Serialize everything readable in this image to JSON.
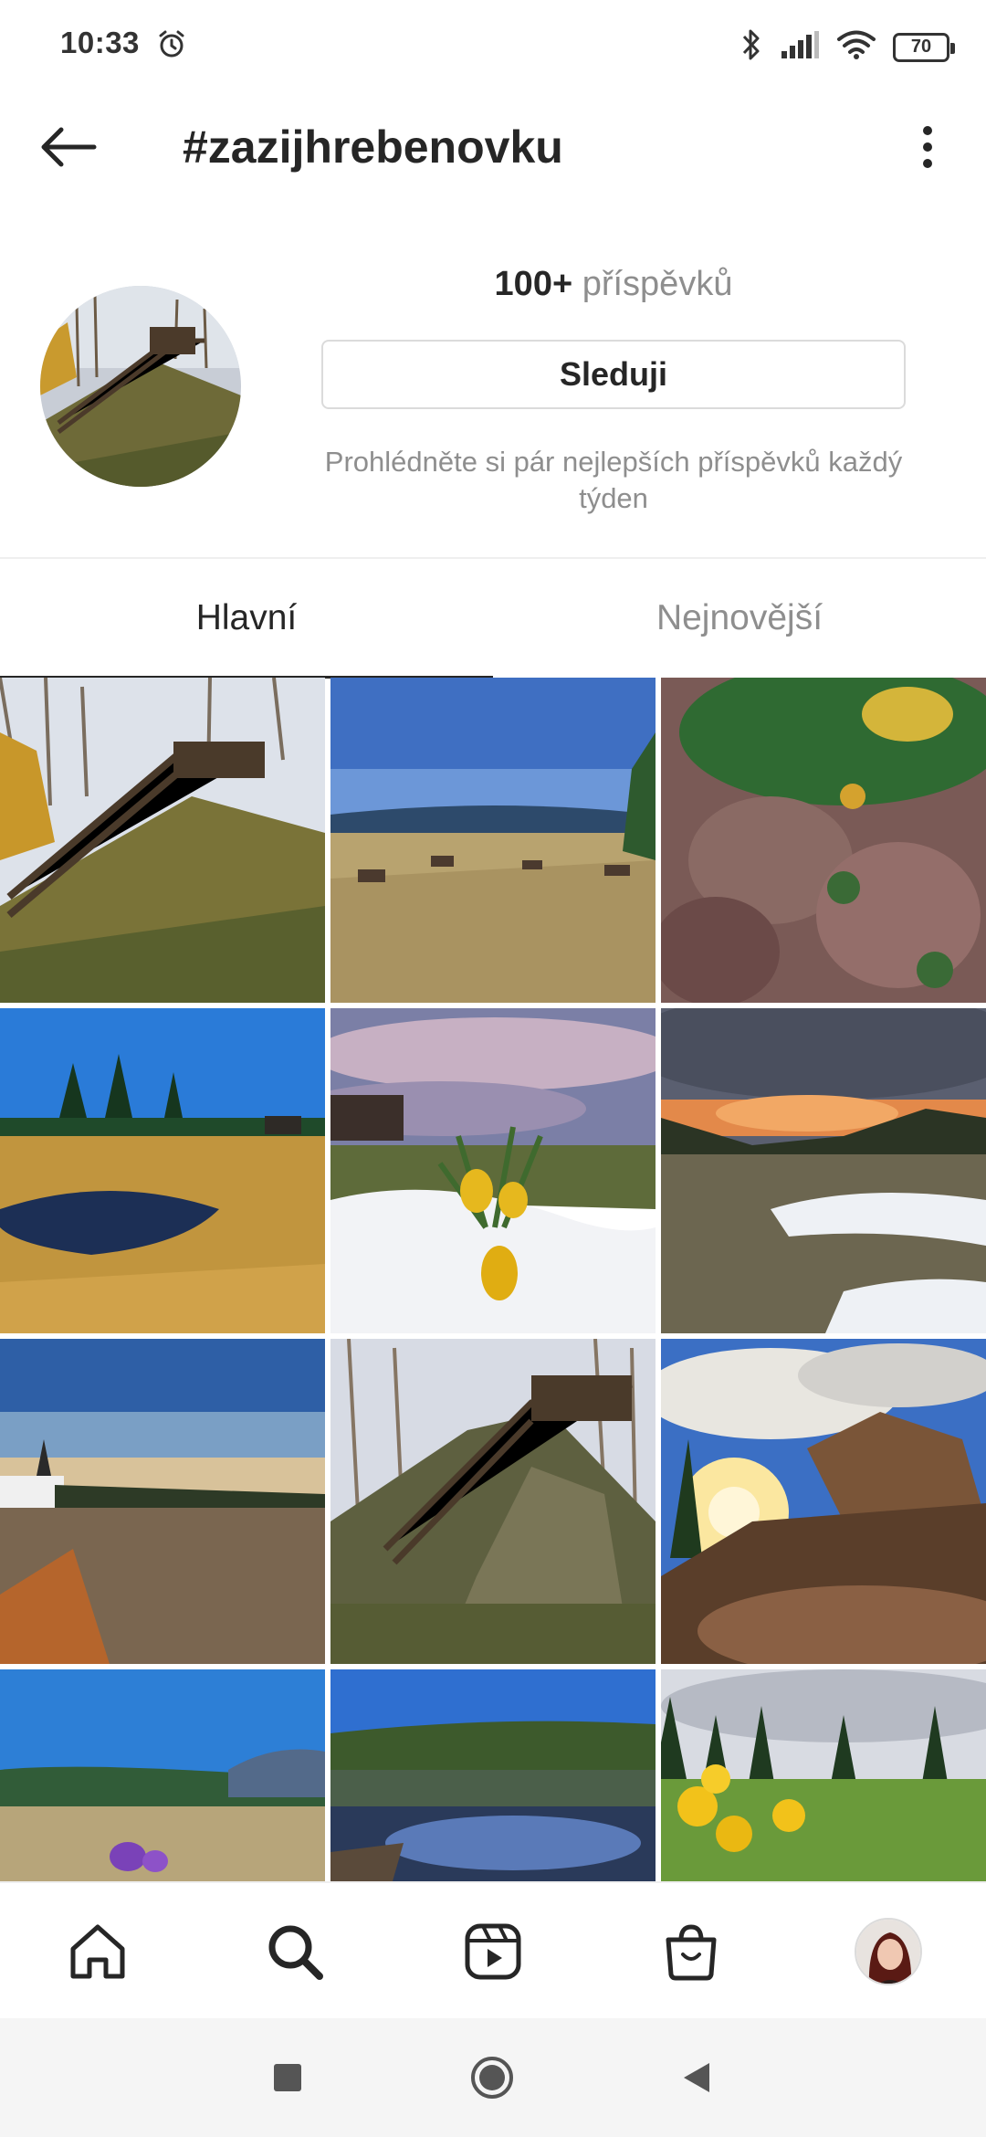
{
  "status_bar": {
    "time": "10:33",
    "battery_level": "70",
    "icons": [
      "alarm-icon",
      "bluetooth-icon",
      "signal-icon",
      "wifi-icon",
      "battery-icon"
    ]
  },
  "header": {
    "title": "#zazijhrebenovku",
    "back_icon": "arrow-left-icon",
    "more_icon": "more-vertical-icon"
  },
  "profile": {
    "posts_count": "100+",
    "posts_label": "příspěvků",
    "follow_label": "Sleduji",
    "helper_text": "Prohlédněte si pár nejlepších příspěvků každý týden"
  },
  "tabs": [
    {
      "label": "Hlavní",
      "active": true
    },
    {
      "label": "Nejnovější",
      "active": false
    }
  ],
  "bottom_nav": {
    "items": [
      "home-icon",
      "search-icon",
      "reels-icon",
      "shop-icon",
      "profile-avatar"
    ]
  },
  "system_nav": {
    "items": [
      "recents-square-icon",
      "home-circle-icon",
      "back-triangle-icon"
    ]
  }
}
